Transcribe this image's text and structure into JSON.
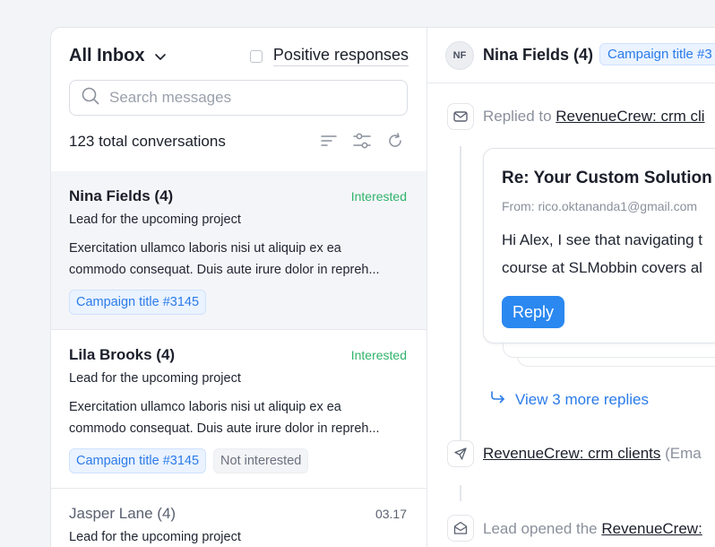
{
  "left_panel": {
    "inbox_label": "All Inbox",
    "positive_label": "Positive responses",
    "search_placeholder": "Search messages",
    "total_label": "123 total conversations",
    "conversations": [
      {
        "name": "Nina Fields (4)",
        "status": "Interested",
        "subtitle": "Lead for the upcoming project",
        "body_line1": "Exercitation ullamco laboris nisi ut aliquip ex ea",
        "body_line2": "commodo consequat. Duis aute irure dolor in repreh...",
        "tag1": "Campaign title #3145"
      },
      {
        "name": "Lila Brooks (4)",
        "status": "Interested",
        "subtitle": "Lead for the upcoming project",
        "body_line1": "Exercitation ullamco laboris nisi ut aliquip ex ea",
        "body_line2": "commodo consequat. Duis aute irure dolor in repreh...",
        "tag1": "Campaign title #3145",
        "tag2": "Not interested"
      },
      {
        "name": "Jasper Lane (4)",
        "date": "03.17",
        "subtitle": "Lead for the upcoming project"
      }
    ]
  },
  "right_panel": {
    "avatar_initials": "NF",
    "contact_name": "Nina Fields (4)",
    "campaign_tag": "Campaign title #3",
    "event1_prefix": "Replied to ",
    "event1_link": "RevenueCrew: crm cli",
    "email": {
      "subject": "Re: Your Custom Solution",
      "from": "From: rico.oktananda1@gmail.com",
      "line1": "Hi Alex, I see that navigating t",
      "line2": "course at SLMobbin covers al",
      "reply_label": "Reply"
    },
    "view_more": "View 3 more replies",
    "event2_link": "RevenueCrew: crm clients",
    "event2_suffix": " (Ema",
    "event3_prefix": "Lead opened the ",
    "event3_link": "RevenueCrew:"
  },
  "colors": {
    "accent": "#2b88f0",
    "interested": "#2fb36b",
    "tag_blue": "#2b7be9"
  }
}
